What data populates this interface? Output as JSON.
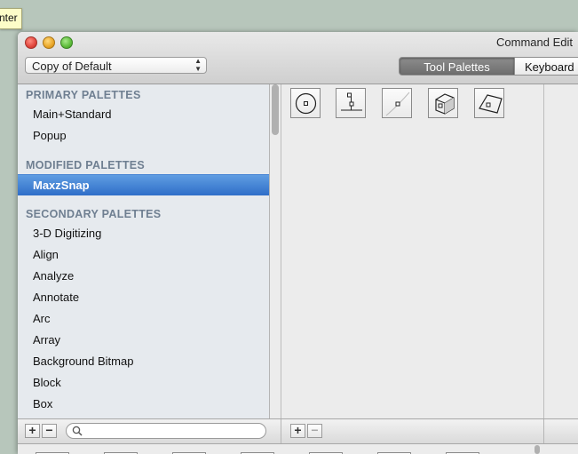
{
  "tooltip": {
    "text": "nter"
  },
  "window": {
    "title": "Command Edit"
  },
  "toolbar": {
    "preset_select": "Copy of Default",
    "tabs": [
      {
        "label": "Tool Palettes",
        "active": true
      },
      {
        "label": "Keyboard",
        "active": false
      }
    ]
  },
  "sidebar": {
    "sections": [
      {
        "title": "PRIMARY PALETTES",
        "items": [
          "Main+Standard",
          "Popup"
        ]
      },
      {
        "title": "MODIFIED PALETTES",
        "items": [
          "MaxzSnap"
        ]
      },
      {
        "title": "SECONDARY PALETTES",
        "items": [
          "3-D Digitizing",
          "Align",
          "Analyze",
          "Annotate",
          "Arc",
          "Array",
          "Background Bitmap",
          "Block",
          "Box"
        ]
      }
    ],
    "selected_item": "MaxzSnap"
  },
  "palette_tools": [
    {
      "icon": "snap-center-icon"
    },
    {
      "icon": "snap-perpendicular-icon"
    },
    {
      "icon": "snap-on-curve-icon"
    },
    {
      "icon": "snap-on-surface-icon"
    },
    {
      "icon": "snap-on-mesh-icon"
    }
  ],
  "bottom": {
    "add_label": "+",
    "remove_label": "−",
    "search_placeholder": ""
  },
  "colors": {
    "selection": "#3f7fd6",
    "section_heading": "#6f7f91",
    "tooltip_bg": "#fdfdc8"
  }
}
